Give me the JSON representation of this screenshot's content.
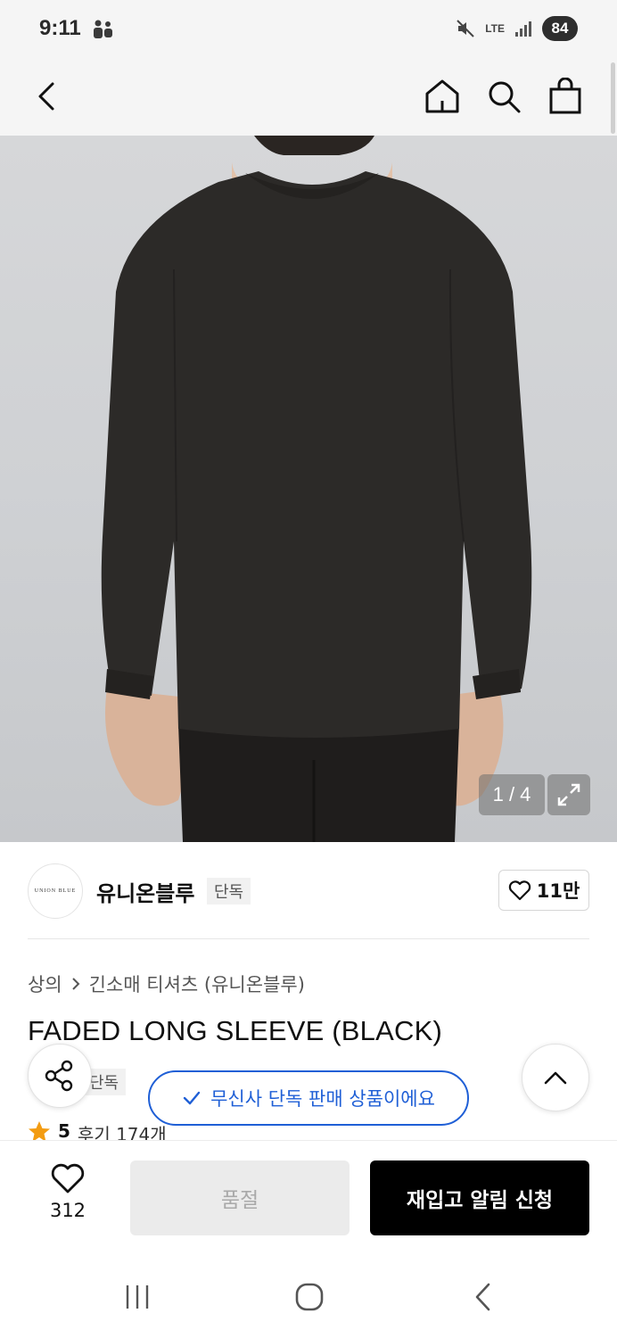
{
  "status_bar": {
    "time": "9:11",
    "network": "LTE",
    "battery": "84"
  },
  "header": {
    "back_icon": "chevron-left-icon",
    "home_icon": "home-icon",
    "search_icon": "search-icon",
    "cart_icon": "shopping-bag-icon"
  },
  "gallery": {
    "counter": "1 / 4",
    "expand_icon": "expand-icon"
  },
  "brand": {
    "logo_text": "UNION BLUE",
    "name": "유니온블루",
    "exclusive_tag": "단독",
    "likes": "11만"
  },
  "product": {
    "breadcrumb": [
      "상의",
      "긴소매 티셔츠 (유니온블루)"
    ],
    "title": "FADED LONG SLEEVE (BLACK)",
    "exclusive_tag": "단독",
    "exclusive_notice": "무신사 단독 판매 상품이에요",
    "rating": "5",
    "reviews": "후기 174개"
  },
  "action_bar": {
    "wish_count": "312",
    "soldout_label": "품절",
    "restock_label": "재입고 알림 신청"
  },
  "colors": {
    "accent_blue": "#1f5fd6",
    "black": "#000000",
    "disabled": "#ebebeb",
    "star": "#f39c12"
  }
}
